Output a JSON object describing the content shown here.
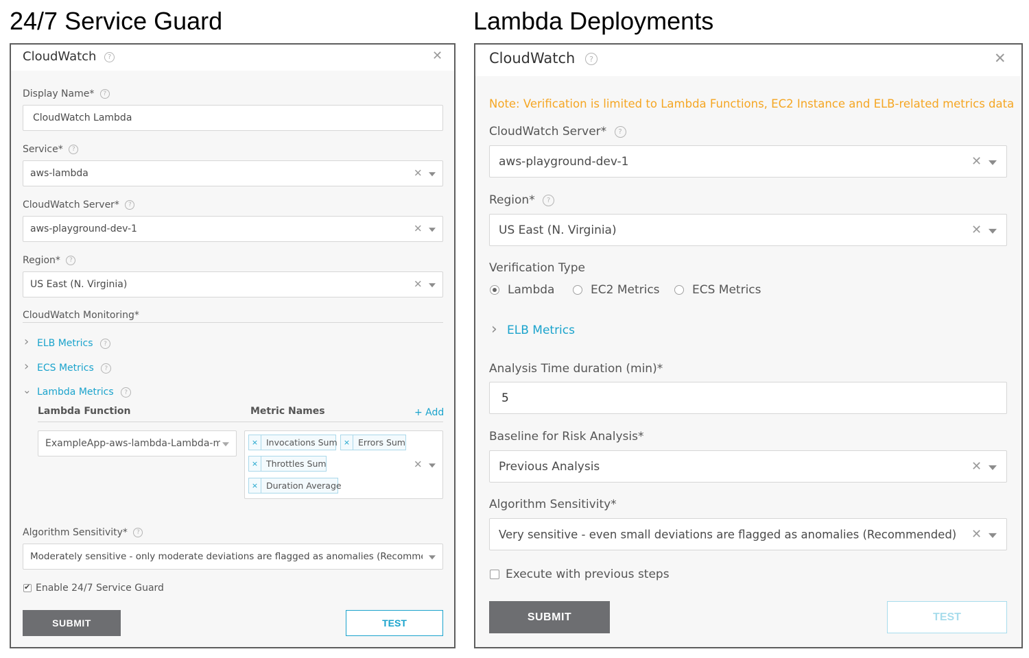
{
  "left": {
    "section_title": "24/7 Service Guard",
    "dialog_title": "CloudWatch",
    "display_name_label": "Display Name*",
    "display_name_value": "CloudWatch Lambda",
    "service_label": "Service*",
    "service_value": "aws-lambda",
    "server_label": "CloudWatch Server*",
    "server_value": "aws-playground-dev-1",
    "region_label": "Region*",
    "region_value": "US East (N. Virginia)",
    "monitoring_label": "CloudWatch Monitoring*",
    "elb_metrics": "ELB Metrics",
    "ecs_metrics": "ECS Metrics",
    "lambda_metrics": "Lambda Metrics",
    "lambda_function_header": "Lambda Function",
    "metric_names_header": "Metric Names",
    "add_label": "+ Add",
    "lambda_function_value": "ExampleApp-aws-lambda-Lambda-my-f...",
    "metric_tags": [
      "Invocations Sum",
      "Errors Sum",
      "Throttles Sum",
      "Duration Average"
    ],
    "sensitivity_label": "Algorithm Sensitivity*",
    "sensitivity_value": "Moderately sensitive - only moderate deviations are flagged as anomalies (Recommended)",
    "enable_label": "Enable 24/7 Service Guard",
    "enable_checked": true,
    "submit": "SUBMIT",
    "test": "TEST"
  },
  "right": {
    "section_title": "Lambda Deployments",
    "dialog_title": "CloudWatch",
    "note": "Note: Verification is limited to Lambda Functions, EC2 Instance and ELB-related metrics data",
    "server_label": "CloudWatch Server*",
    "server_value": "aws-playground-dev-1",
    "region_label": "Region*",
    "region_value": "US East (N. Virginia)",
    "verification_type_label": "Verification Type",
    "radio_options": [
      "Lambda",
      "EC2 Metrics",
      "ECS Metrics"
    ],
    "selected_radio": "Lambda",
    "elb_metrics": "ELB Metrics",
    "analysis_label": "Analysis Time duration (min)*",
    "analysis_value": "5",
    "baseline_label": "Baseline for Risk Analysis*",
    "baseline_value": "Previous Analysis",
    "sensitivity_label": "Algorithm Sensitivity*",
    "sensitivity_value": "Very sensitive - even small deviations are flagged as anomalies (Recommended)",
    "execute_label": "Execute with previous steps",
    "execute_checked": false,
    "submit": "SUBMIT",
    "test": "TEST"
  },
  "colors": {
    "accent": "#1aa3cc",
    "note": "#f5a623",
    "submit_bg": "#6d6e71"
  },
  "icons": {
    "help": "?",
    "close": "✕",
    "chevron_right": "›",
    "chevron_down": "⌄",
    "check": "✔"
  }
}
